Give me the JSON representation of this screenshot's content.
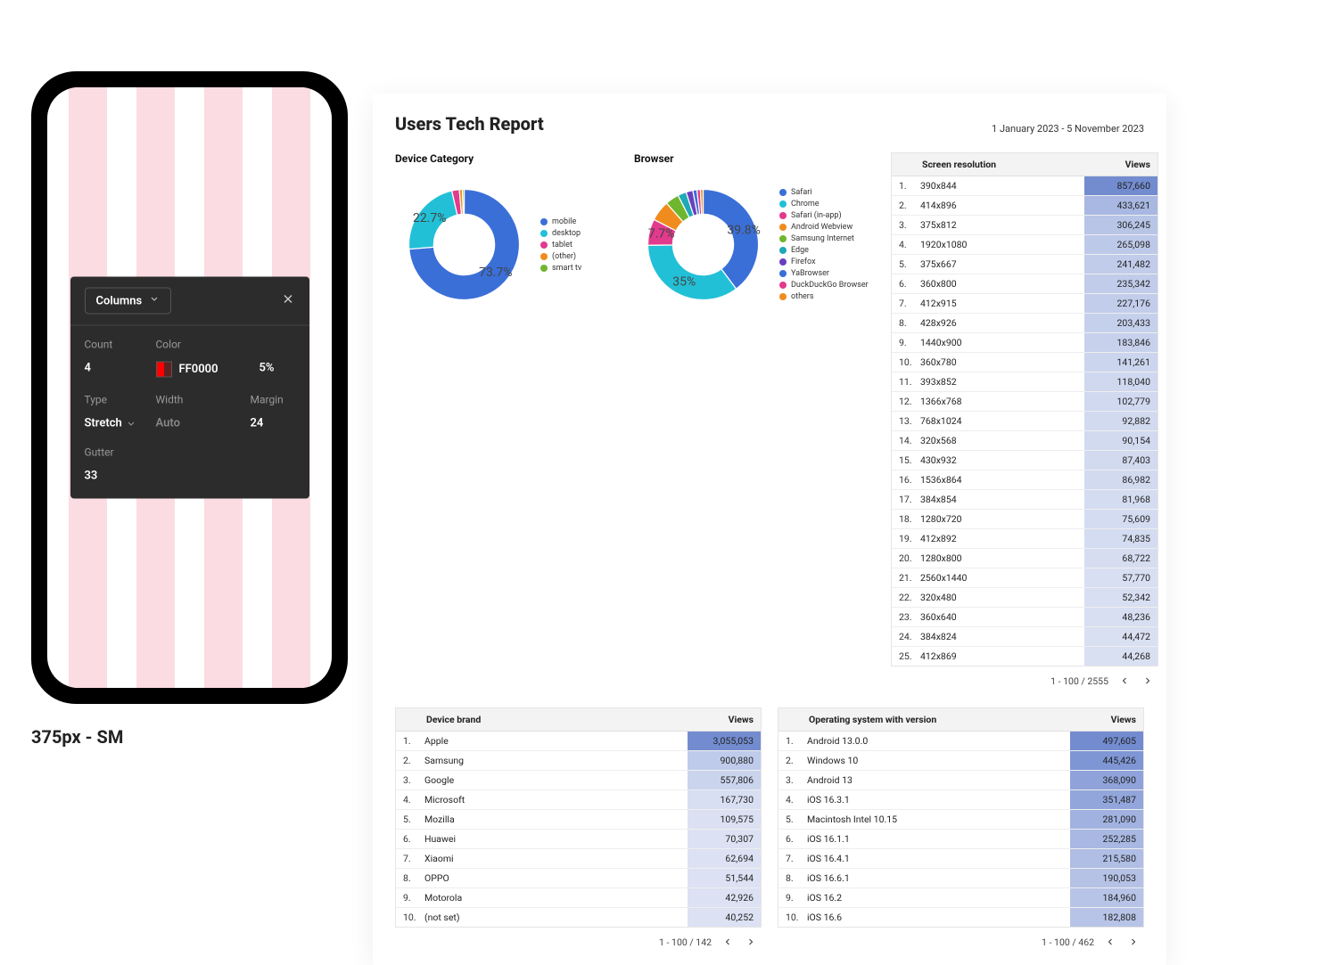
{
  "phone": {
    "caption": "375px - SM",
    "panel": {
      "title": "Columns",
      "count_label": "Count",
      "count_value": "4",
      "color_label": "Color",
      "color_hex": "FF0000",
      "opacity": "5%",
      "type_label": "Type",
      "type_value": "Stretch",
      "width_label": "Width",
      "width_value": "Auto",
      "margin_label": "Margin",
      "margin_value": "24",
      "gutter_label": "Gutter",
      "gutter_value": "33"
    }
  },
  "report": {
    "title": "Users Tech Report",
    "date_range": "1 January 2023 - 5 November 2023",
    "views_header": "Views"
  },
  "chart_data": [
    {
      "type": "pie",
      "title": "Device Category",
      "series": [
        {
          "name": "mobile",
          "value": 73.7,
          "color": "#3a6fd8"
        },
        {
          "name": "desktop",
          "value": 22.7,
          "color": "#22c0d6"
        },
        {
          "name": "tablet",
          "value": 2.2,
          "color": "#e23a8c"
        },
        {
          "name": "(other)",
          "value": 0.9,
          "color": "#f08c1e"
        },
        {
          "name": "smart tv",
          "value": 0.5,
          "color": "#6fb62f"
        }
      ],
      "labels": [
        {
          "text": "73.7%",
          "for": "mobile"
        },
        {
          "text": "22.7%",
          "for": "desktop"
        }
      ]
    },
    {
      "type": "pie",
      "title": "Browser",
      "series": [
        {
          "name": "Safari",
          "value": 39.8,
          "color": "#3a6fd8"
        },
        {
          "name": "Chrome",
          "value": 35.0,
          "color": "#22c0d6"
        },
        {
          "name": "Safari (in-app)",
          "value": 7.7,
          "color": "#e23a8c"
        },
        {
          "name": "Android Webview",
          "value": 6.0,
          "color": "#f08c1e"
        },
        {
          "name": "Samsung Internet",
          "value": 4.0,
          "color": "#6fb62f"
        },
        {
          "name": "Edge",
          "value": 2.5,
          "color": "#20a8b8"
        },
        {
          "name": "Firefox",
          "value": 2.0,
          "color": "#6a3fbf"
        },
        {
          "name": "YaBrowser",
          "value": 1.2,
          "color": "#3a6fd8"
        },
        {
          "name": "DuckDuckGo Browser",
          "value": 1.0,
          "color": "#e23a8c"
        },
        {
          "name": "others",
          "value": 0.8,
          "color": "#f08c1e"
        }
      ],
      "labels": [
        {
          "text": "39.8%",
          "for": "Safari"
        },
        {
          "text": "35%",
          "for": "Chrome"
        },
        {
          "text": "7.7%",
          "for": "Safari (in-app)"
        }
      ]
    }
  ],
  "tables": {
    "device_brand": {
      "title": "Device brand",
      "pager": "1 - 100 / 142",
      "rows": [
        {
          "name": "Apple",
          "views": 3055053
        },
        {
          "name": "Samsung",
          "views": 900880
        },
        {
          "name": "Google",
          "views": 557806
        },
        {
          "name": "Microsoft",
          "views": 167730
        },
        {
          "name": "Mozilla",
          "views": 109575
        },
        {
          "name": "Huawei",
          "views": 70307
        },
        {
          "name": "Xiaomi",
          "views": 62694
        },
        {
          "name": "OPPO",
          "views": 51544
        },
        {
          "name": "Motorola",
          "views": 42926
        },
        {
          "name": "(not set)",
          "views": 40252
        }
      ]
    },
    "os_version": {
      "title": "Operating system with version",
      "pager": "1 - 100 / 462",
      "rows": [
        {
          "name": "Android 13.0.0",
          "views": 497605
        },
        {
          "name": "Windows 10",
          "views": 445426
        },
        {
          "name": "Android 13",
          "views": 368090
        },
        {
          "name": "iOS 16.3.1",
          "views": 351487
        },
        {
          "name": "Macintosh Intel 10.15",
          "views": 281090
        },
        {
          "name": "iOS 16.1.1",
          "views": 252285
        },
        {
          "name": "iOS 16.4.1",
          "views": 215580
        },
        {
          "name": "iOS 16.6.1",
          "views": 190053
        },
        {
          "name": "iOS 16.2",
          "views": 184960
        },
        {
          "name": "iOS 16.6",
          "views": 182808
        }
      ]
    },
    "screen_res": {
      "title": "Screen resolution",
      "pager": "1 - 100 / 2555",
      "rows": [
        {
          "name": "390x844",
          "views": 857660
        },
        {
          "name": "414x896",
          "views": 433621
        },
        {
          "name": "375x812",
          "views": 306245
        },
        {
          "name": "1920x1080",
          "views": 265098
        },
        {
          "name": "375x667",
          "views": 241482
        },
        {
          "name": "360x800",
          "views": 235342
        },
        {
          "name": "412x915",
          "views": 227176
        },
        {
          "name": "428x926",
          "views": 203433
        },
        {
          "name": "1440x900",
          "views": 183846
        },
        {
          "name": "360x780",
          "views": 141261
        },
        {
          "name": "393x852",
          "views": 118040
        },
        {
          "name": "1366x768",
          "views": 102779
        },
        {
          "name": "768x1024",
          "views": 92882
        },
        {
          "name": "320x568",
          "views": 90154
        },
        {
          "name": "430x932",
          "views": 87403
        },
        {
          "name": "1536x864",
          "views": 86982
        },
        {
          "name": "384x854",
          "views": 81968
        },
        {
          "name": "1280x720",
          "views": 75609
        },
        {
          "name": "412x892",
          "views": 74835
        },
        {
          "name": "1280x800",
          "views": 68722
        },
        {
          "name": "2560x1440",
          "views": 57770
        },
        {
          "name": "320x480",
          "views": 52342
        },
        {
          "name": "360x640",
          "views": 48236
        },
        {
          "name": "384x824",
          "views": 44472
        },
        {
          "name": "412x869",
          "views": 44268
        }
      ]
    }
  }
}
